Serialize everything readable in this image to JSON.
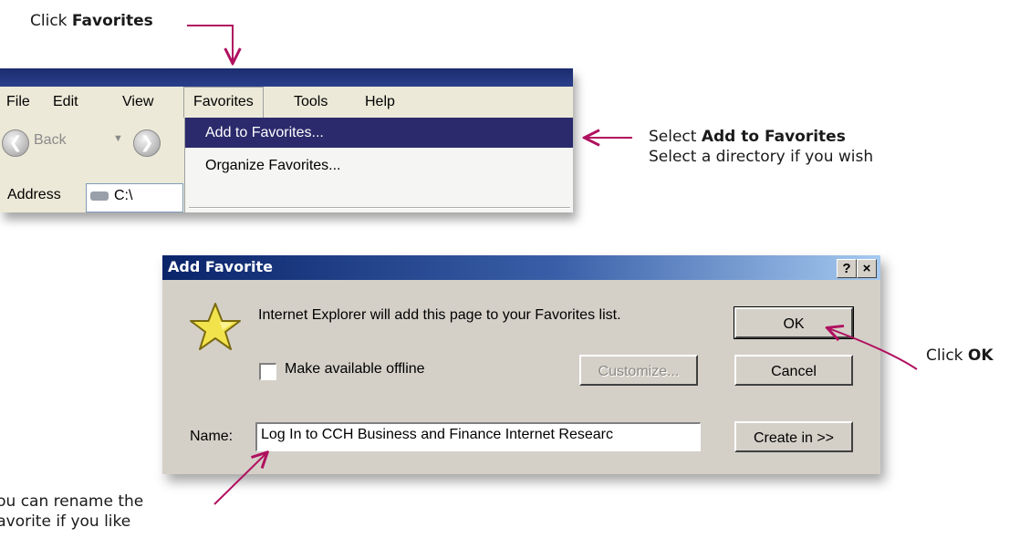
{
  "annotations": {
    "click_favorites_prefix": "Click",
    "click_favorites_bold": "Favorites",
    "select_add_prefix": "Select",
    "select_add_bold": "Add to Favorites",
    "select_directory": "Select a directory if you wish",
    "click_ok_prefix": "Click",
    "click_ok_bold": "OK",
    "rename_line1": "You can rename the",
    "rename_line2": "Favorite if you like"
  },
  "menubar": {
    "items": [
      "File",
      "Edit",
      "View",
      "Favorites",
      "Tools",
      "Help"
    ]
  },
  "toolbar": {
    "back_label": "Back"
  },
  "address": {
    "label": "Address",
    "value": "C:\\"
  },
  "favorites_menu": {
    "items": [
      "Add to Favorites...",
      "Organize Favorites..."
    ]
  },
  "dialog": {
    "title": "Add Favorite",
    "help_button": "?",
    "close_button": "×",
    "message": "Internet Explorer will add this page to your Favorites list.",
    "offline_label": "Make available offline",
    "offline_checked": false,
    "ok_label": "OK",
    "cancel_label": "Cancel",
    "customize_label": "Customize...",
    "name_label": "Name:",
    "name_value": "Log In to CCH Business and Finance Internet Researc",
    "create_in_label": "Create in >>"
  },
  "colors": {
    "arrow": "#b0105f",
    "menu_highlight": "#2b2a6c",
    "dialog_title_start": "#0a246a",
    "dialog_title_end": "#a6caf0"
  },
  "icons": [
    "back-icon",
    "forward-icon",
    "drive-icon",
    "star-icon"
  ]
}
